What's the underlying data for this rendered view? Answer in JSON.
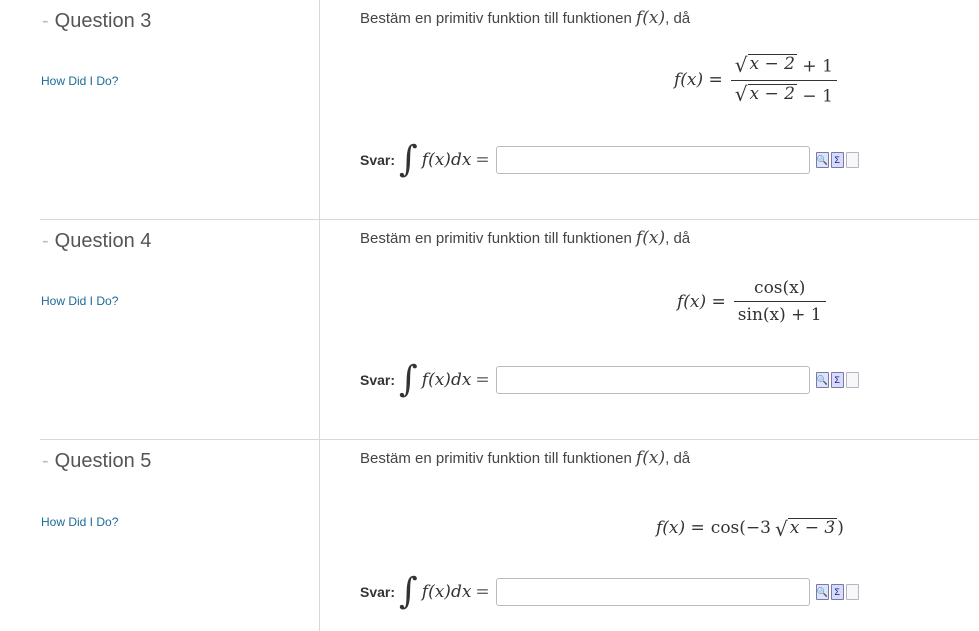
{
  "questions": [
    {
      "title": "Question 3",
      "how_link": "How Did I Do?",
      "prompt_text": "Bestäm en primitiv funktion till funktionen ",
      "prompt_fx": "f(x)",
      "prompt_suffix": ", då",
      "formula": {
        "lhs": "f(x) =",
        "num_sqrt": "x − 2",
        "num_rest": " + 1",
        "den_sqrt": "x − 2",
        "den_rest": " − 1"
      },
      "answer_label": "Svar:",
      "integral_symbol": "∫",
      "integrand": "f(x)dx",
      "equals": "=",
      "input_value": ""
    },
    {
      "title": "Question 4",
      "how_link": "How Did I Do?",
      "prompt_text": "Bestäm en primitiv funktion till funktionen ",
      "prompt_fx": "f(x)",
      "prompt_suffix": ", då",
      "formula": {
        "lhs": "f(x) =",
        "num": "cos(x)",
        "den": "sin(x) + 1"
      },
      "answer_label": "Svar:",
      "integral_symbol": "∫",
      "integrand": "f(x)dx",
      "equals": "=",
      "input_value": ""
    },
    {
      "title": "Question 5",
      "how_link": "How Did I Do?",
      "prompt_text": "Bestäm en primitiv funktion till funktionen ",
      "prompt_fx": "f(x)",
      "prompt_suffix": ", då",
      "formula": {
        "lhs": "f(x) =",
        "pre": "cos(−3",
        "sqrt": "x − 3",
        "post": ")"
      },
      "answer_label": "Svar:",
      "integral_symbol": "∫",
      "integrand": "f(x)dx",
      "equals": "=",
      "input_value": ""
    }
  ],
  "tools": {
    "icons": [
      "preview-icon",
      "sum-icon",
      "blank-page-icon"
    ],
    "preview_glyph": "🔍",
    "sum_glyph": "Σ"
  }
}
